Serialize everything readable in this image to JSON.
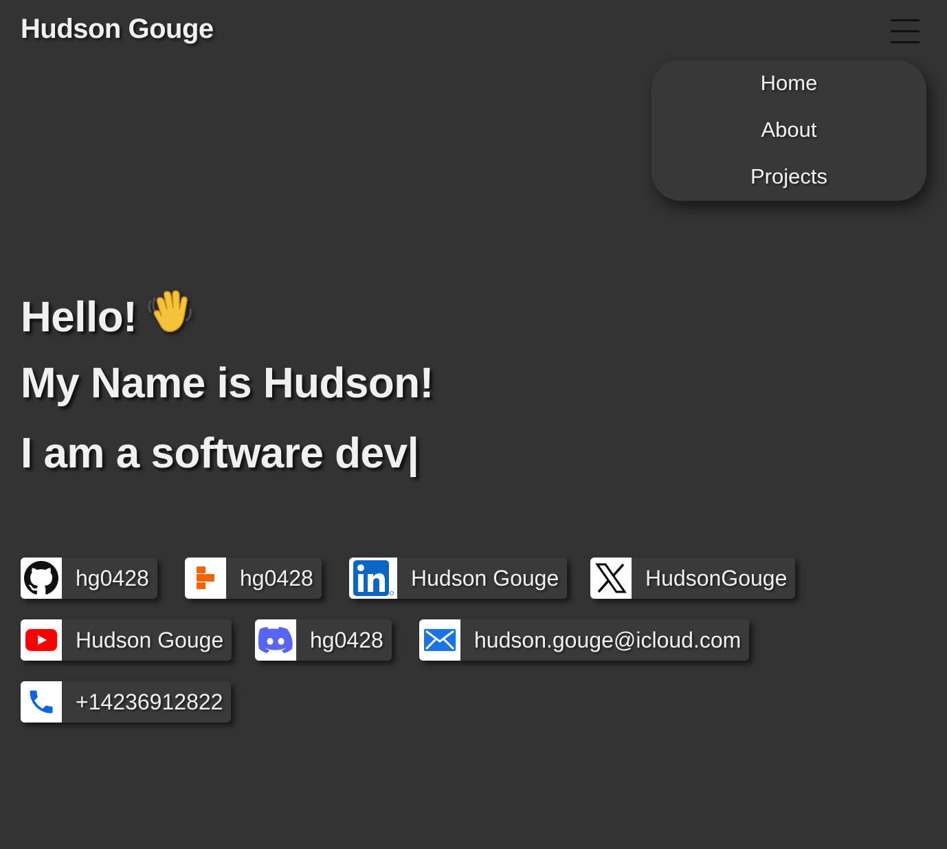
{
  "header": {
    "title": "Hudson Gouge",
    "menu_icon": "hamburger-menu-icon"
  },
  "nav": {
    "items": [
      {
        "label": "Home"
      },
      {
        "label": "About"
      },
      {
        "label": "Projects"
      }
    ]
  },
  "hero": {
    "greeting": "Hello!",
    "greeting_icon": "waving-hand-icon",
    "name_line": "My Name is Hudson!",
    "typing_line": "I am a software dev|"
  },
  "contacts": [
    {
      "icon": "github-icon",
      "label": "hg0428"
    },
    {
      "icon": "replit-icon",
      "label": "hg0428"
    },
    {
      "icon": "linkedin-icon",
      "label": "Hudson Gouge"
    },
    {
      "icon": "x-icon",
      "label": "HudsonGouge"
    },
    {
      "icon": "youtube-icon",
      "label": "Hudson Gouge"
    },
    {
      "icon": "discord-icon",
      "label": "hg0428"
    },
    {
      "icon": "mail-icon",
      "label": "hudson.gouge@icloud.com"
    },
    {
      "icon": "phone-icon",
      "label": "+14236912822"
    }
  ],
  "colors": {
    "background": "#333333",
    "menu_background": "#383838",
    "text": "#f0f0f0",
    "youtube_red": "#ff0000",
    "linkedin_blue": "#0a66c2",
    "discord_blurple": "#5865f2",
    "mail_blue": "#1a73e8",
    "phone_blue": "#0a66e0",
    "replit_orange": "#f26207"
  }
}
